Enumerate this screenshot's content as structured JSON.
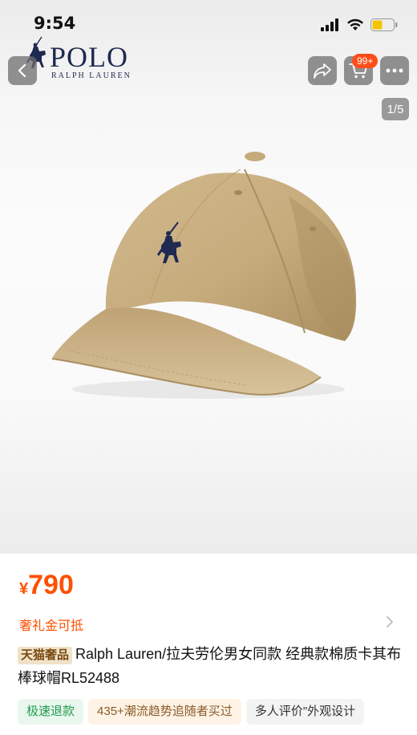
{
  "status": {
    "time": "9:54"
  },
  "brand": {
    "name": "POLO",
    "subtitle": "RALPH LAUREN"
  },
  "cart": {
    "badge": "99+"
  },
  "gallery": {
    "index": "1/5"
  },
  "product": {
    "currency": "¥",
    "price": "790",
    "promo": "奢礼金可抵",
    "store_tag": "天猫奢品",
    "title": "Ralph Lauren/拉夫劳伦男女同款 经典款棉质卡其布棒球帽RL52488",
    "tags": [
      "极速退款",
      "435+潮流趋势追随者买过",
      "多人评价\"外观设计"
    ]
  },
  "colors": {
    "price": "#ff5000",
    "cap": "#c8ae80",
    "logo": "#1f2a52"
  }
}
